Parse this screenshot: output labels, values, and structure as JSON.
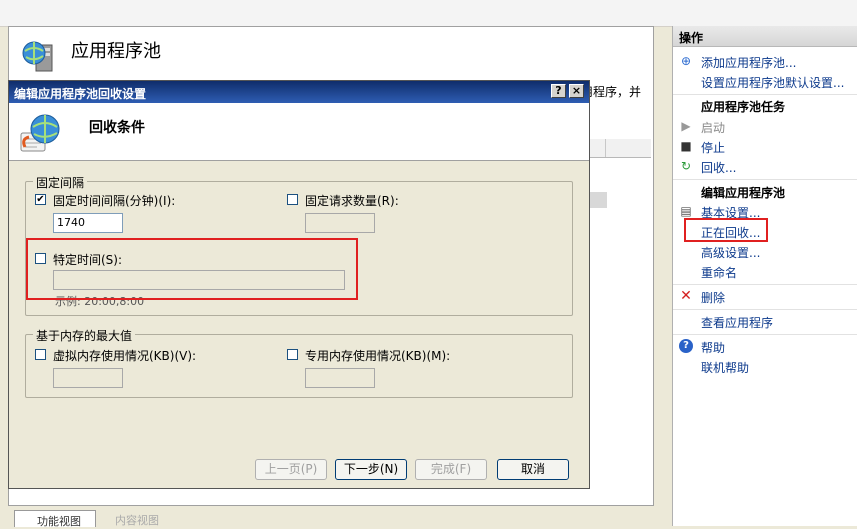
{
  "main": {
    "page_title": "应用程序池",
    "description_tail": "用程序，并",
    "tabs": {
      "feature_view": "功能视图",
      "content_view": "内容视图"
    }
  },
  "actions": {
    "header": "操作",
    "items": [
      {
        "label": "添加应用程序池...",
        "icon": "add-pool-icon"
      },
      {
        "label": "设置应用程序池默认设置...",
        "icon": ""
      }
    ],
    "task_header": "应用程序池任务",
    "tasks": [
      {
        "label": "启动",
        "icon": "play-icon",
        "disabled": true
      },
      {
        "label": "停止",
        "icon": "stop-icon"
      },
      {
        "label": "回收...",
        "icon": "recycle-icon"
      }
    ],
    "edit_header": "编辑应用程序池",
    "edit_items": [
      {
        "label": "基本设置...",
        "icon": "basic-settings-icon"
      },
      {
        "label": "正在回收...",
        "icon": ""
      },
      {
        "label": "高级设置...",
        "icon": ""
      },
      {
        "label": "重命名",
        "icon": ""
      }
    ],
    "delete": {
      "label": "删除",
      "icon": "delete-icon"
    },
    "view_apps": "查看应用程序",
    "help": {
      "label": "帮助",
      "icon": "help-icon"
    },
    "online_help": "联机帮助"
  },
  "dialog": {
    "title": "编辑应用程序池回收设置",
    "help_btn": "?",
    "close_btn": "×",
    "banner_title": "回收条件",
    "fixed_intervals": {
      "legend": "固定间隔",
      "regular_time": {
        "label": "固定时间间隔(分钟)(I):",
        "checked": true,
        "value": "1740"
      },
      "request_limit": {
        "label": "固定请求数量(R):",
        "checked": false,
        "value": ""
      },
      "specific_time": {
        "label": "特定时间(S):",
        "checked": false,
        "value": "",
        "example": "示例: 20:00,8:00"
      }
    },
    "memory": {
      "legend": "基于内存的最大值",
      "virtual": {
        "label": "虚拟内存使用情况(KB)(V):",
        "checked": false,
        "value": ""
      },
      "private": {
        "label": "专用内存使用情况(KB)(M):",
        "checked": false,
        "value": ""
      }
    },
    "buttons": {
      "prev": "上一页(P)",
      "next": "下一步(N)",
      "finish": "完成(F)",
      "cancel": "取消"
    }
  },
  "colors": {
    "highlight": "#e02020",
    "link": "#0d3a8c",
    "title_bar": "#0f2d6b"
  }
}
